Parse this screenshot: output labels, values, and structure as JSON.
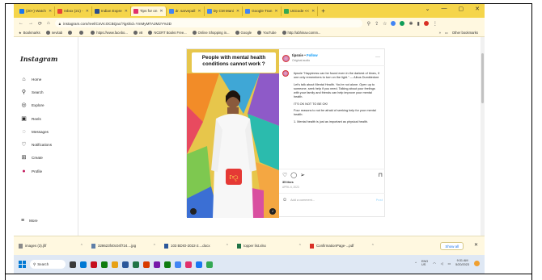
{
  "browser": {
    "tabs": [
      {
        "label": "(20+) Watch",
        "color": "#1877f2"
      },
      {
        "label": "Inbox (21) -",
        "color": "#ea4335"
      },
      {
        "label": "Indian Expre",
        "color": "#2a4d8f"
      },
      {
        "label": "Tips for on",
        "color": "#e1306c",
        "active": true
      },
      {
        "label": "dr. sarvepall",
        "color": "#4285f4"
      },
      {
        "label": "Dy CM Mani",
        "color": "#4285f4"
      },
      {
        "label": "Google Tran",
        "color": "#4285f4"
      },
      {
        "label": "Unicode <<",
        "color": "#34a853"
      }
    ],
    "new_tab": "+",
    "window_controls": [
      "⌄",
      "—",
      "▢",
      "✕"
    ],
    "url": "instagram.com/reel/CsVIcOCBQac/?igshid=YmMyMTA2M2Y%3D",
    "bookmarks_label": "Bookmarks",
    "bookmarks": [
      "nevitab",
      "",
      "",
      "https://www.facebo...",
      "v8",
      "NCERT Books Free...",
      "Online Shopping in...",
      "Google",
      "YouTube",
      "http://abhinav.comm..."
    ],
    "other_bookmarks": "Other bookmarks"
  },
  "instagram": {
    "logo": "Instagram",
    "nav": [
      {
        "label": "Home",
        "icon": "home-icon",
        "glyph": "⌂"
      },
      {
        "label": "Search",
        "icon": "search-icon",
        "glyph": "⚲"
      },
      {
        "label": "Explore",
        "icon": "explore-icon",
        "glyph": "◎"
      },
      {
        "label": "Reels",
        "icon": "reels-icon",
        "glyph": "▣"
      },
      {
        "label": "Messages",
        "icon": "messages-icon",
        "glyph": "◌"
      },
      {
        "label": "Notifications",
        "icon": "heart-icon",
        "glyph": "♡"
      },
      {
        "label": "Create",
        "icon": "create-icon",
        "glyph": "⊞"
      },
      {
        "label": "Profile",
        "icon": "profile-icon",
        "glyph": "●"
      }
    ],
    "more": "More",
    "post": {
      "overlay_text": "People with mental health conditions cannot work ?",
      "username": "tipsnie",
      "follow": "Follow",
      "audio": "Original audio",
      "caption": [
        "tipsnie \"Happiness can be found even in the darkest of times, if one only remembers to turn on the light.\" — Albus Dumbledore",
        "Let's talk about Mental Health. You're not alone. Open up to someone, seek help if you need. Talking about your feelings with your family and friends can help improve your mental health.",
        "IT'S OK NOT TO BE OK!",
        "Four reasons to not be afraid of seeking help for your mental health:",
        "1. Mental health is just as important as physical health."
      ],
      "likes": "35 likes",
      "ago": "APRIL 6, 2023",
      "comment_placeholder": "Add a comment...",
      "post_label": "Post"
    }
  },
  "downloads": {
    "items": [
      "images (3).jfif",
      "328623f40c04f724....jpg",
      "103 BDIO-2022-2....docx",
      "topper list.xlsx",
      "ConfirmationPage-...pdf"
    ],
    "show_all": "Show all"
  },
  "taskbar": {
    "search": "Search",
    "lang": "ENG\nUS",
    "time": "9:31 AM",
    "date": "5/20/2023",
    "app_colors": [
      "#3a3a3a",
      "#0078d4",
      "#c50f1f",
      "#0f7b0f",
      "#e7a117",
      "#2b579a",
      "#217346",
      "#d83b01",
      "#7719aa",
      "#107c10",
      "#4285f4",
      "#e1306c",
      "#1877f2",
      "#34a853"
    ]
  }
}
